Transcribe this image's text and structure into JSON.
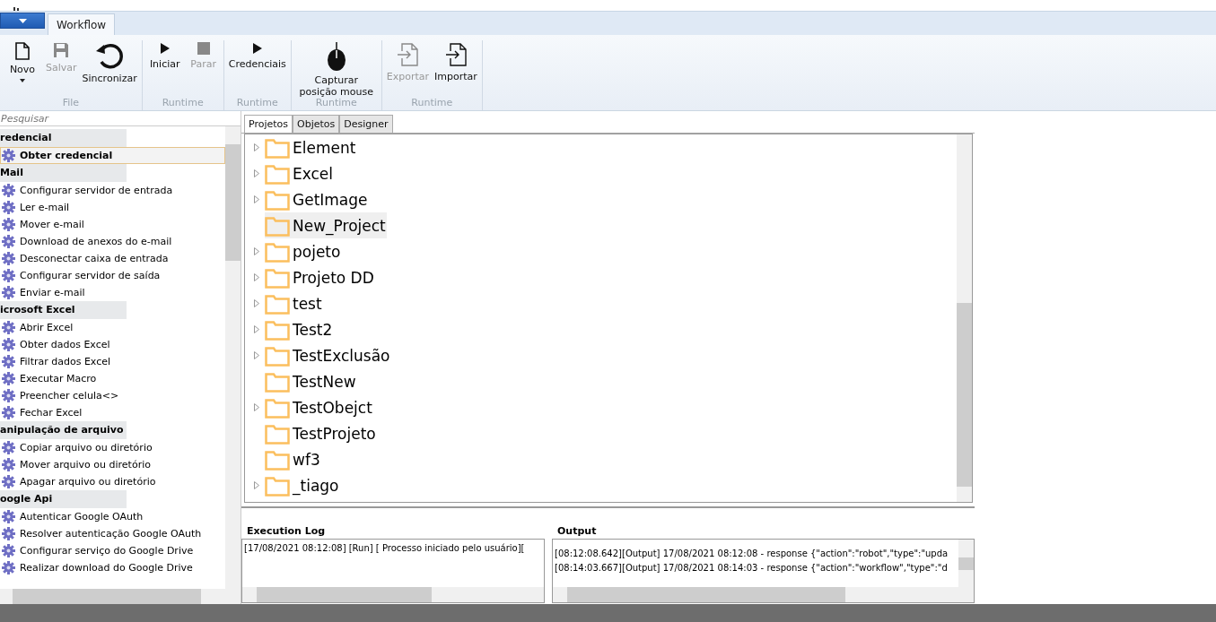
{
  "ribbon": {
    "tabs": [
      {
        "label": "Workflow",
        "selected": true
      }
    ],
    "groups": [
      {
        "label": "File",
        "buttons": [
          {
            "label": "Novo",
            "kind": "page",
            "disabled": false,
            "dropdown": true
          },
          {
            "label": "Salvar",
            "kind": "save",
            "disabled": true,
            "dropdown": false
          },
          {
            "label": "Sincronizar",
            "kind": "sync",
            "disabled": false,
            "dropdown": false
          }
        ]
      },
      {
        "label": "Runtime",
        "buttons": [
          {
            "label": "Iniciar",
            "kind": "play",
            "disabled": false,
            "dropdown": false
          },
          {
            "label": "Parar",
            "kind": "stop",
            "disabled": true,
            "dropdown": false
          }
        ]
      },
      {
        "label": "Runtime",
        "buttons": [
          {
            "label": "Credenciais",
            "kind": "play",
            "disabled": false,
            "dropdown": false
          }
        ]
      },
      {
        "label": "Runtime",
        "buttons": [
          {
            "label": "Capturar posição mouse",
            "kind": "mouse",
            "disabled": false,
            "dropdown": false
          }
        ]
      },
      {
        "label": "Runtime",
        "buttons": [
          {
            "label": "Exportar",
            "kind": "export",
            "disabled": true,
            "dropdown": false
          },
          {
            "label": "Importar",
            "kind": "import",
            "disabled": false,
            "dropdown": false
          }
        ]
      }
    ]
  },
  "sidebar": {
    "search": {
      "placeholder": "Pesquisar"
    },
    "groups": [
      {
        "title": "redencial",
        "items": [
          {
            "label": "Obter credencial",
            "selected": true
          }
        ]
      },
      {
        "title": "Mail",
        "items": [
          {
            "label": "Configurar servidor de entrada",
            "selected": false
          },
          {
            "label": "Ler e-mail",
            "selected": false
          },
          {
            "label": "Mover e-mail",
            "selected": false
          },
          {
            "label": "Download de anexos do e-mail",
            "selected": false
          },
          {
            "label": "Desconectar caixa de entrada",
            "selected": false
          },
          {
            "label": "Configurar servidor de saída",
            "selected": false
          },
          {
            "label": "Enviar e-mail",
            "selected": false
          }
        ]
      },
      {
        "title": "icrosoft Excel",
        "items": [
          {
            "label": "Abrir Excel",
            "selected": false
          },
          {
            "label": "Obter dados Excel",
            "selected": false
          },
          {
            "label": "Filtrar dados Excel",
            "selected": false
          },
          {
            "label": "Executar Macro",
            "selected": false
          },
          {
            "label": "Preencher celula<>",
            "selected": false
          },
          {
            "label": "Fechar Excel",
            "selected": false
          }
        ]
      },
      {
        "title": "anipulação de arquivo",
        "items": [
          {
            "label": "Copiar arquivo ou diretório",
            "selected": false
          },
          {
            "label": "Mover arquivo ou diretório",
            "selected": false
          },
          {
            "label": "Apagar arquivo ou diretório",
            "selected": false
          }
        ]
      },
      {
        "title": "oogle Api",
        "items": [
          {
            "label": "Autenticar Google OAuth",
            "selected": false
          },
          {
            "label": "Resolver autenticação Google OAuth",
            "selected": false
          },
          {
            "label": "Configurar serviço do Google Drive",
            "selected": false
          },
          {
            "label": "Realizar download do Google Drive",
            "selected": false
          }
        ]
      }
    ]
  },
  "tabs": [
    {
      "label": "Projetos",
      "selected": true
    },
    {
      "label": "Objetos",
      "selected": false
    },
    {
      "label": "Designer",
      "selected": false
    }
  ],
  "projects": [
    {
      "name": "Element",
      "expandable": true,
      "selected": false
    },
    {
      "name": "Excel",
      "expandable": true,
      "selected": false
    },
    {
      "name": "GetImage",
      "expandable": true,
      "selected": false
    },
    {
      "name": "New_Project",
      "expandable": false,
      "selected": true
    },
    {
      "name": "pojeto",
      "expandable": true,
      "selected": false
    },
    {
      "name": "Projeto DD",
      "expandable": true,
      "selected": false
    },
    {
      "name": "test",
      "expandable": true,
      "selected": false
    },
    {
      "name": "Test2",
      "expandable": true,
      "selected": false
    },
    {
      "name": "TestExclusão",
      "expandable": true,
      "selected": false
    },
    {
      "name": "TestNew",
      "expandable": false,
      "selected": false
    },
    {
      "name": "TestObejct",
      "expandable": true,
      "selected": false
    },
    {
      "name": "TestProjeto",
      "expandable": false,
      "selected": false
    },
    {
      "name": "wf3",
      "expandable": false,
      "selected": false
    },
    {
      "name": "_tiago",
      "expandable": true,
      "selected": false
    }
  ],
  "execution_log": {
    "title": "Execution Log",
    "lines": [
      "[17/08/2021 08:12:08] [Run] [ Processo iniciado pelo usuário]["
    ]
  },
  "output": {
    "title": "Output",
    "lines": [
      "[08:12:08.642][Output] 17/08/2021 08:12:08 - response {\"action\":\"robot\",\"type\":\"upda",
      "[08:14:03.667][Output] 17/08/2021 08:14:03 - response {\"action\":\"workflow\",\"type\":\"d"
    ]
  }
}
